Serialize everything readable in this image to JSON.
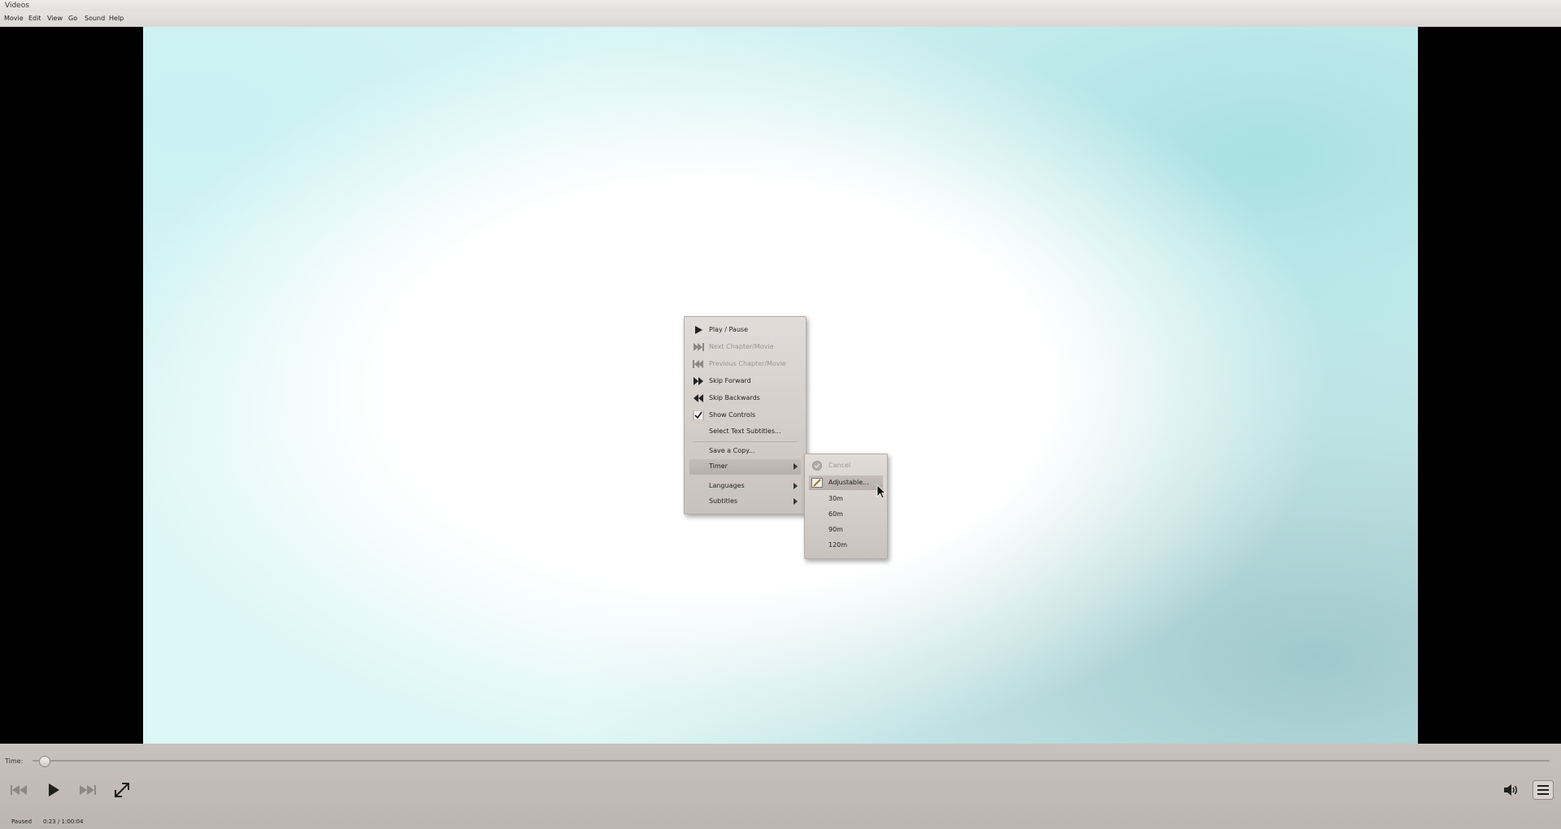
{
  "window": {
    "title": "Videos"
  },
  "menubar": {
    "items": [
      "Movie",
      "Edit",
      "View",
      "Go",
      "Sound",
      "Help"
    ]
  },
  "context_menu": {
    "items": [
      {
        "label": "Play / Pause",
        "icon": "play-icon",
        "enabled": true
      },
      {
        "label": "Next Chapter/Movie",
        "icon": "next-icon",
        "enabled": false
      },
      {
        "label": "Previous Chapter/Movie",
        "icon": "previous-icon",
        "enabled": false
      },
      {
        "label": "Skip Forward",
        "icon": "skip-forward-icon",
        "enabled": true
      },
      {
        "label": "Skip Backwards",
        "icon": "skip-backward-icon",
        "enabled": true
      },
      {
        "label": "Show Controls",
        "icon": "checkmark-icon",
        "checked": true,
        "enabled": true
      },
      {
        "label": "Select Text Subtitles...",
        "enabled": true
      },
      {
        "label": "Save a Copy...",
        "enabled": true
      },
      {
        "label": "Timer",
        "submenu": true,
        "highlighted": true
      },
      {
        "label": "Languages",
        "submenu": true
      },
      {
        "label": "Subtitles",
        "submenu": true
      }
    ]
  },
  "timer_submenu": {
    "items": [
      {
        "label": "Cancel",
        "icon": "cancel-icon",
        "enabled": false
      },
      {
        "label": "Adjustable...",
        "icon": "pencil-icon",
        "highlighted": true
      },
      {
        "label": "30m"
      },
      {
        "label": "60m"
      },
      {
        "label": "90m"
      },
      {
        "label": "120m"
      }
    ]
  },
  "controls": {
    "time_label": "Time:",
    "progress_fraction": 0.0063,
    "status": "Paused",
    "timestamp": "0:23 / 1:00:04"
  },
  "colors": {
    "chrome_bg": "#c0bab7",
    "menu_highlight": "#b7afab",
    "video_bg": "#000000"
  }
}
